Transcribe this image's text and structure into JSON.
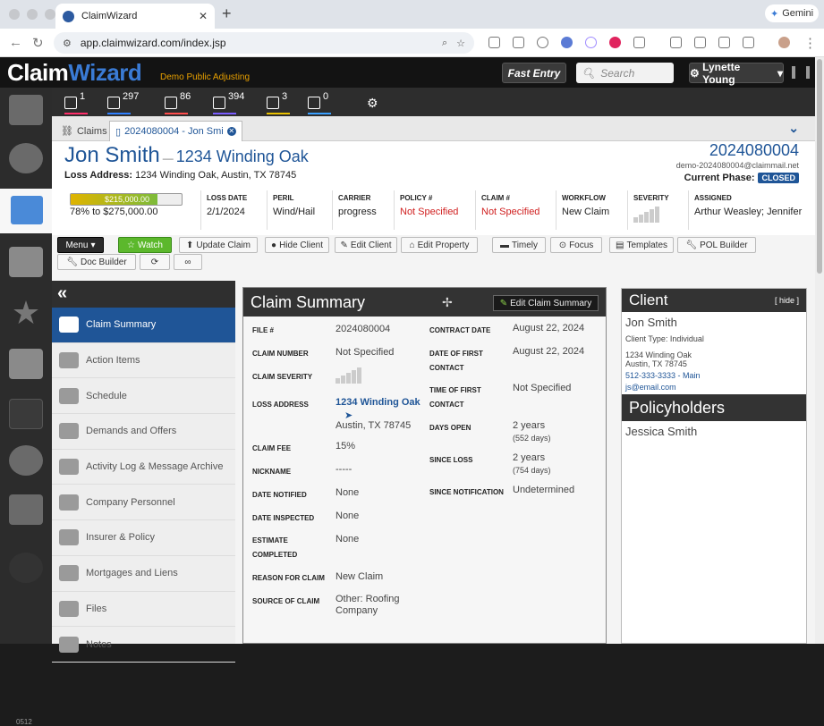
{
  "browser": {
    "tab_title": "ClaimWizard",
    "url": "app.claimwizard.com/index.jsp",
    "gemini_label": "Gemini"
  },
  "app": {
    "logo_text_a": "Claim",
    "logo_text_b": "Wizard",
    "company": "Demo Public Adjusting",
    "fast_entry": "Fast Entry",
    "search_placeholder": "Search",
    "user_name": "Lynette Young"
  },
  "notifications": [
    {
      "icon": "warning-icon",
      "count": "1",
      "color": "#ff2d6a"
    },
    {
      "icon": "chat-icon",
      "count": "297",
      "color": "#2d7fff"
    },
    {
      "icon": "calendar-icon",
      "count": "86",
      "color": "#ff4d4d"
    },
    {
      "icon": "document-icon",
      "count": "394",
      "color": "#7a5cff"
    },
    {
      "icon": "alarm-icon",
      "count": "3",
      "color": "#e8c000"
    },
    {
      "icon": "mail-icon",
      "count": "0",
      "color": "#3aa0ff"
    }
  ],
  "rail": {
    "version": "0512"
  },
  "tabs": [
    {
      "label": "Claims",
      "active": false
    },
    {
      "label": "2024080004 - Jon Smi",
      "active": true
    }
  ],
  "claim": {
    "name": "Jon Smith",
    "separator": "—",
    "address_short": "1234 Winding Oak",
    "loss_address_label": "Loss Address:",
    "loss_address": "1234 Winding Oak, Austin, TX 78745",
    "file_number": "2024080004",
    "email": "demo-2024080004@claimmail.net",
    "phase_label": "Current Phase:",
    "phase": "CLOSED",
    "money_amount": "$215,000.00",
    "money_text": "78% to $275,000.00",
    "money_progress": 0.78
  },
  "metrics": [
    {
      "label": "LOSS DATE",
      "value": "2/1/2024",
      "red": false
    },
    {
      "label": "PERIL",
      "value": "Wind/Hail",
      "red": false
    },
    {
      "label": "CARRIER",
      "value": "progress",
      "red": false
    },
    {
      "label": "POLICY #",
      "value": "Not Specified",
      "red": true
    },
    {
      "label": "CLAIM #",
      "value": "Not Specified",
      "red": true
    },
    {
      "label": "WORKFLOW",
      "value": "New Claim",
      "red": false
    },
    {
      "label": "SEVERITY",
      "value": "",
      "red": false
    },
    {
      "label": "ASSIGNED",
      "value": "Arthur Weasley; Jennifer",
      "red": false
    }
  ],
  "actions": {
    "menu": "Menu",
    "watch": "Watch",
    "update_claim": "Update Claim",
    "hide_client": "Hide Client",
    "edit_client": "Edit Client",
    "edit_property": "Edit Property",
    "timely": "Timely",
    "focus": "Focus",
    "templates": "Templates",
    "pol_builder": "POL Builder",
    "doc_builder": "Doc Builder"
  },
  "menu": [
    {
      "label": "Claim Summary",
      "icon": "house-icon",
      "active": true
    },
    {
      "label": "Action Items",
      "icon": "checklist-icon",
      "active": false
    },
    {
      "label": "Schedule",
      "icon": "calendar-icon",
      "active": false
    },
    {
      "label": "Demands and Offers",
      "icon": "money-hands-icon",
      "active": false
    },
    {
      "label": "Activity Log & Message Archive",
      "icon": "clock-icon",
      "active": false
    },
    {
      "label": "Company Personnel",
      "icon": "people-icon",
      "active": false
    },
    {
      "label": "Insurer & Policy",
      "icon": "shield-icon",
      "active": false
    },
    {
      "label": "Mortgages and Liens",
      "icon": "bank-icon",
      "active": false
    },
    {
      "label": "Files",
      "icon": "files-icon",
      "active": false
    },
    {
      "label": "Notes",
      "icon": "notes-icon",
      "active": false
    }
  ],
  "summary": {
    "title": "Claim Summary",
    "edit_label": "Edit Claim Summary",
    "file_label": "FILE #",
    "file_value": "2024080004",
    "claim_number_label": "CLAIM NUMBER",
    "claim_number_value": "Not Specified",
    "claim_severity_label": "CLAIM SEVERITY",
    "loss_address_label": "LOSS ADDRESS",
    "loss_address_line1": "1234 Winding Oak",
    "loss_address_line2": "Austin, TX 78745",
    "claim_fee_label": "CLAIM FEE",
    "claim_fee_value": "15%",
    "nickname_label": "NICKNAME",
    "nickname_value": "-----",
    "date_notified_label": "DATE NOTIFIED",
    "date_notified_value": "None",
    "date_inspected_label": "DATE INSPECTED",
    "date_inspected_value": "None",
    "estimate_completed_label_1": "ESTIMATE",
    "estimate_completed_label_2": "COMPLETED",
    "estimate_completed_value": "None",
    "reason_label": "REASON FOR CLAIM",
    "reason_value": "New Claim",
    "source_label": "SOURCE OF CLAIM",
    "source_value_1": "Other: Roofing",
    "source_value_2": "Company",
    "contract_date_label": "CONTRACT DATE",
    "contract_date_value": "August 22, 2024",
    "first_contact_label_1": "DATE OF FIRST",
    "first_contact_label_2": "CONTACT",
    "first_contact_value": "August 22, 2024",
    "time_first_contact_label_1": "TIME OF FIRST",
    "time_first_contact_label_2": "CONTACT",
    "time_first_contact_value": "Not Specified",
    "days_open_label": "DAYS OPEN",
    "days_open_value": "2 years",
    "days_open_sub": "(552 days)",
    "since_loss_label": "SINCE LOSS",
    "since_loss_value": "2 years",
    "since_loss_sub": "(754 days)",
    "since_notification_label": "SINCE NOTIFICATION",
    "since_notification_value": "Undetermined"
  },
  "client": {
    "title": "Client",
    "hide": "[ hide ]",
    "name": "Jon Smith",
    "type": "Client Type: Individual",
    "address1": "1234 Winding Oak",
    "address2": "Austin, TX 78745",
    "phone": "512-333-3333 - Main",
    "email": "js@email.com",
    "policyholders_title": "Policyholders",
    "policyholder": "Jessica Smith"
  }
}
